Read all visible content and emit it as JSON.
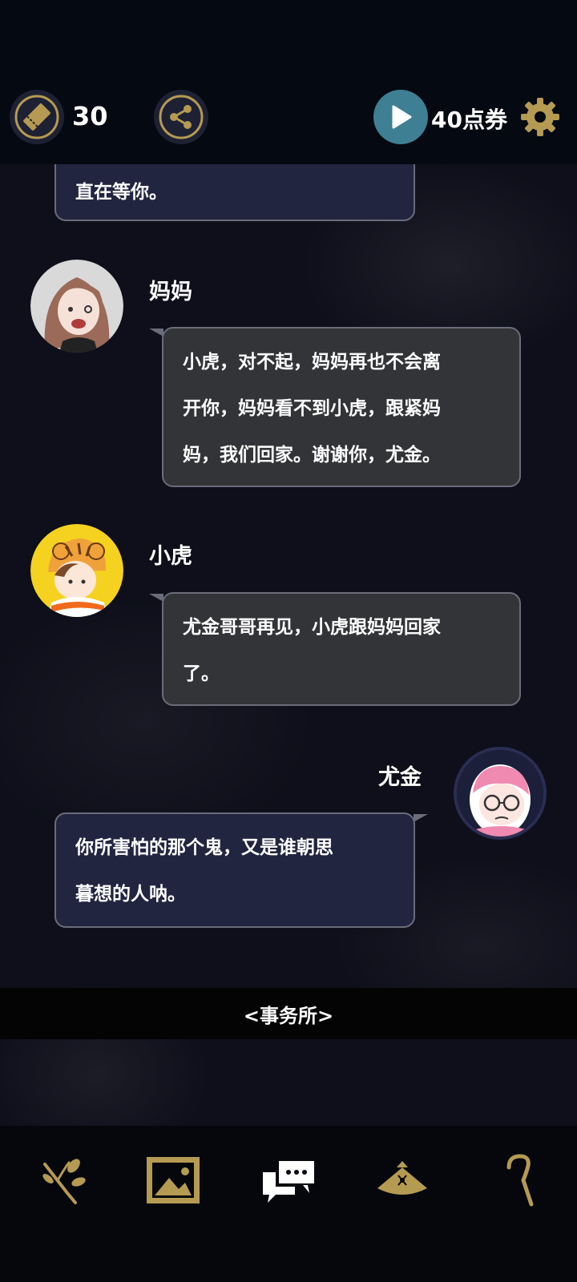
{
  "header": {
    "ticket_count": "30",
    "points_label": "40点券",
    "icons": [
      "ticket-icon",
      "share-icon",
      "play-icon",
      "gear-icon"
    ]
  },
  "messages": [
    {
      "speaker": "",
      "side": "me",
      "text_lines": [
        "直在等你。"
      ]
    },
    {
      "speaker": "妈妈",
      "side": "left",
      "text_lines": [
        "小虎，对不起，妈妈再也不会离",
        "开你，妈妈看不到小虎，跟紧妈",
        "妈，我们回家。谢谢你，尤金。"
      ]
    },
    {
      "speaker": "小虎",
      "side": "left",
      "text_lines": [
        "尤金哥哥再见，小虎跟妈妈回家",
        "了。"
      ]
    },
    {
      "speaker": "尤金",
      "side": "right",
      "text_lines": [
        "你所害怕的那个鬼，又是谁朝思",
        "暮想的人呐。"
      ]
    }
  ],
  "location": "<事务所>",
  "bottom_nav": {
    "items": [
      "branch-icon",
      "gallery-icon",
      "chat-icon",
      "hat-icon",
      "cane-icon"
    ]
  },
  "colors": {
    "accent_gold": "#b59a52",
    "play_teal": "#3e7f93",
    "npc_bubble": "#333437",
    "player_bubble": "#212540"
  }
}
